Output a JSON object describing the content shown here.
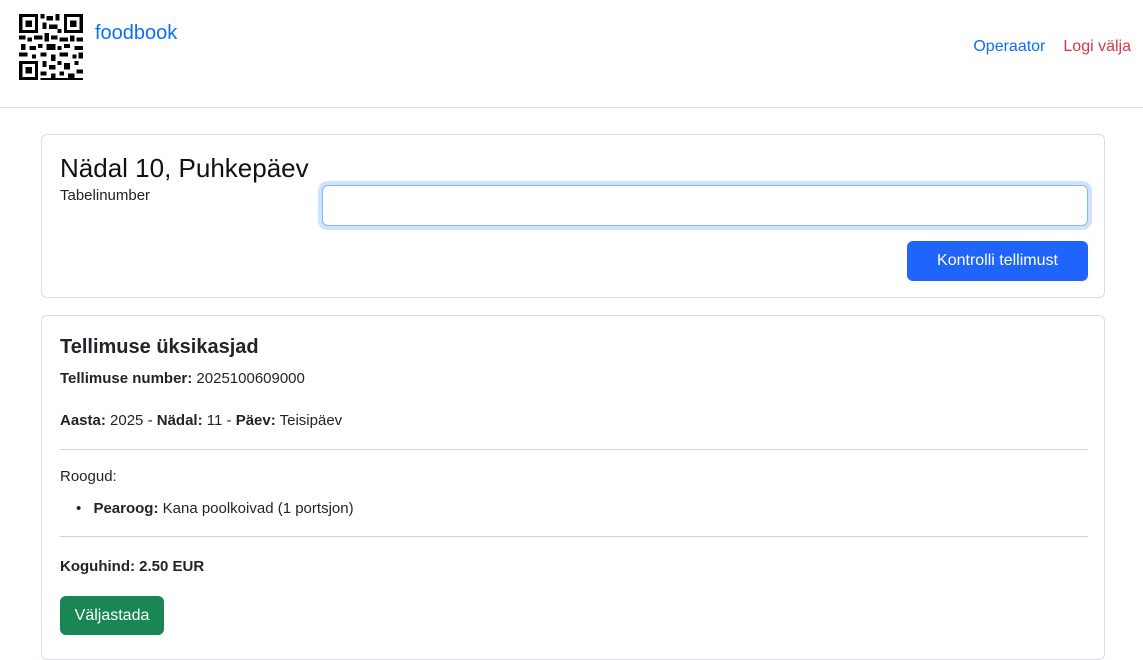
{
  "brand": {
    "name": "foodbook"
  },
  "nav": {
    "operator_label": "Operaator",
    "logout_label": "Logi välja"
  },
  "lookup": {
    "title": "Nädal 10, Puhkepäev",
    "field_label": "Tabelinumber",
    "input_value": "",
    "input_placeholder": "",
    "button_label": "Kontrolli tellimust"
  },
  "details": {
    "title": "Tellimuse üksikasjad",
    "order_number_label": "Tellimuse number:",
    "order_number": "2025100609000",
    "year_label": "Aasta:",
    "year": "2025",
    "week_label": "Nädal:",
    "week": "11",
    "day_label": "Päev:",
    "day": "Teisipäev",
    "dishes_label": "Roogud:",
    "dishes": [
      {
        "label": "Pearoog:",
        "text": "Kana poolkoivad (1 portsjon)"
      }
    ],
    "total_label": "Koguhind:",
    "total_value": "2.50 EUR",
    "issue_button_label": "Väljastada"
  },
  "colors": {
    "primary": "#0d6efd",
    "danger": "#dc3545",
    "success": "#198754"
  }
}
